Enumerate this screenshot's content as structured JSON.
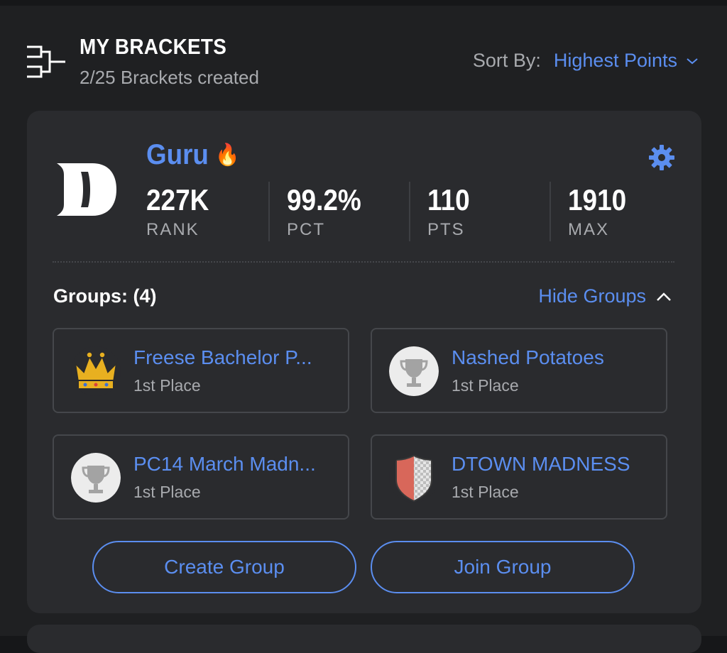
{
  "header": {
    "title": "MY BRACKETS",
    "subtitle": "2/25 Brackets created",
    "sort_label": "Sort By:",
    "sort_value": "Highest Points"
  },
  "bracket": {
    "name": "Guru",
    "stats": [
      {
        "value": "227K",
        "label": "RANK"
      },
      {
        "value": "99.2%",
        "label": "PCT"
      },
      {
        "value": "110",
        "label": "PTS"
      },
      {
        "value": "1910",
        "label": "MAX"
      }
    ],
    "groups_heading": "Groups: (4)",
    "hide_groups_label": "Hide Groups",
    "groups": [
      {
        "name": "Freese Bachelor P...",
        "place": "1st Place",
        "icon": "crown-icon"
      },
      {
        "name": "Nashed Potatoes",
        "place": "1st Place",
        "icon": "trophy-icon"
      },
      {
        "name": "PC14 March Madn...",
        "place": "1st Place",
        "icon": "trophy-icon"
      },
      {
        "name": "DTOWN MADNESS",
        "place": "1st Place",
        "icon": "shield-icon"
      }
    ],
    "create_group_label": "Create Group",
    "join_group_label": "Join Group"
  },
  "colors": {
    "accent": "#5b8ef0",
    "background": "#1f2022",
    "card": "#2a2b2e",
    "muted_text": "#a8aaae"
  }
}
